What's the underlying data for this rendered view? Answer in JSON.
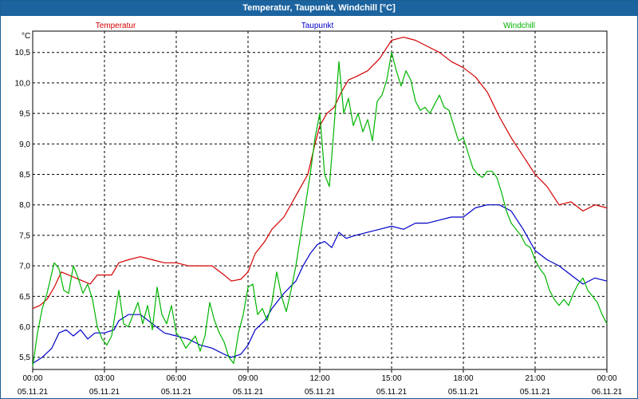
{
  "window": {
    "title": "Temperatur, Taupunkt, Windchill [°C]"
  },
  "chart_data": {
    "type": "line",
    "title": "Temperatur, Taupunkt, Windchill [°C]",
    "ylabel": "°C",
    "xlabel": "",
    "ylim": [
      5.3,
      10.85
    ],
    "xlim": [
      0,
      24
    ],
    "grid": true,
    "legend_position": "top",
    "y_ticks": [
      "5,5",
      "6,0",
      "6,5",
      "7,0",
      "7,5",
      "8,0",
      "8,5",
      "9,0",
      "9,5",
      "10,0",
      "10,5"
    ],
    "y_tick_values": [
      5.5,
      6.0,
      6.5,
      7.0,
      7.5,
      8.0,
      8.5,
      9.0,
      9.5,
      10.0,
      10.5
    ],
    "x_ticks": [
      {
        "t": 0,
        "time": "00:00",
        "date": "05.11.21"
      },
      {
        "t": 3,
        "time": "03:00",
        "date": "05.11.21"
      },
      {
        "t": 6,
        "time": "06:00",
        "date": "05.11.21"
      },
      {
        "t": 9,
        "time": "09:00",
        "date": "05.11.21"
      },
      {
        "t": 12,
        "time": "12:00",
        "date": "05.11.21"
      },
      {
        "t": 15,
        "time": "15:00",
        "date": "05.11.21"
      },
      {
        "t": 18,
        "time": "18:00",
        "date": "05.11.21"
      },
      {
        "t": 21,
        "time": "21:00",
        "date": "05.11.21"
      },
      {
        "t": 24,
        "time": "00:00",
        "date": "06.11.21"
      }
    ],
    "series": [
      {
        "name": "Temperatur",
        "color": "#d40000",
        "points": [
          [
            0,
            6.3
          ],
          [
            0.3,
            6.35
          ],
          [
            0.6,
            6.45
          ],
          [
            0.9,
            6.65
          ],
          [
            1.2,
            6.9
          ],
          [
            1.5,
            6.85
          ],
          [
            1.8,
            6.8
          ],
          [
            2.1,
            6.75
          ],
          [
            2.4,
            6.7
          ],
          [
            2.7,
            6.85
          ],
          [
            3.0,
            6.85
          ],
          [
            3.3,
            6.85
          ],
          [
            3.6,
            7.05
          ],
          [
            4.0,
            7.1
          ],
          [
            4.5,
            7.15
          ],
          [
            5.0,
            7.1
          ],
          [
            5.5,
            7.05
          ],
          [
            6.0,
            7.05
          ],
          [
            6.5,
            7.0
          ],
          [
            7.0,
            7.0
          ],
          [
            7.5,
            7.0
          ],
          [
            8.0,
            6.85
          ],
          [
            8.3,
            6.75
          ],
          [
            8.7,
            6.78
          ],
          [
            9.0,
            6.9
          ],
          [
            9.3,
            7.2
          ],
          [
            9.7,
            7.4
          ],
          [
            10.0,
            7.6
          ],
          [
            10.5,
            7.8
          ],
          [
            11.0,
            8.15
          ],
          [
            11.5,
            8.5
          ],
          [
            11.8,
            9.0
          ],
          [
            12.0,
            9.3
          ],
          [
            12.3,
            9.5
          ],
          [
            12.6,
            9.6
          ],
          [
            12.9,
            9.85
          ],
          [
            13.2,
            10.05
          ],
          [
            13.5,
            10.1
          ],
          [
            14.0,
            10.2
          ],
          [
            14.5,
            10.4
          ],
          [
            15.0,
            10.7
          ],
          [
            15.5,
            10.75
          ],
          [
            16.0,
            10.7
          ],
          [
            16.5,
            10.6
          ],
          [
            17.0,
            10.5
          ],
          [
            17.5,
            10.35
          ],
          [
            18.0,
            10.25
          ],
          [
            18.5,
            10.1
          ],
          [
            19.0,
            9.85
          ],
          [
            19.5,
            9.45
          ],
          [
            20.0,
            9.1
          ],
          [
            20.5,
            8.8
          ],
          [
            21.0,
            8.5
          ],
          [
            21.5,
            8.3
          ],
          [
            22.0,
            8.0
          ],
          [
            22.5,
            8.05
          ],
          [
            23.0,
            7.9
          ],
          [
            23.5,
            8.0
          ],
          [
            24.0,
            7.95
          ]
        ]
      },
      {
        "name": "Taupunkt",
        "color": "#0000c8",
        "points": [
          [
            0,
            5.4
          ],
          [
            0.4,
            5.5
          ],
          [
            0.8,
            5.65
          ],
          [
            1.1,
            5.9
          ],
          [
            1.4,
            5.95
          ],
          [
            1.7,
            5.85
          ],
          [
            2.0,
            5.95
          ],
          [
            2.3,
            5.8
          ],
          [
            2.6,
            5.9
          ],
          [
            3.0,
            5.9
          ],
          [
            3.4,
            5.95
          ],
          [
            3.6,
            6.1
          ],
          [
            4.0,
            6.2
          ],
          [
            4.5,
            6.2
          ],
          [
            5.0,
            6.05
          ],
          [
            5.5,
            5.9
          ],
          [
            6.0,
            5.85
          ],
          [
            6.5,
            5.8
          ],
          [
            7.0,
            5.7
          ],
          [
            7.5,
            5.65
          ],
          [
            8.0,
            5.55
          ],
          [
            8.3,
            5.5
          ],
          [
            8.7,
            5.55
          ],
          [
            9.0,
            5.7
          ],
          [
            9.3,
            5.95
          ],
          [
            9.7,
            6.1
          ],
          [
            10.0,
            6.3
          ],
          [
            10.5,
            6.55
          ],
          [
            11.0,
            6.75
          ],
          [
            11.3,
            7.0
          ],
          [
            11.6,
            7.2
          ],
          [
            11.9,
            7.35
          ],
          [
            12.2,
            7.4
          ],
          [
            12.5,
            7.3
          ],
          [
            12.8,
            7.55
          ],
          [
            13.1,
            7.45
          ],
          [
            13.5,
            7.5
          ],
          [
            14.0,
            7.55
          ],
          [
            14.5,
            7.6
          ],
          [
            15.0,
            7.65
          ],
          [
            15.5,
            7.6
          ],
          [
            16.0,
            7.7
          ],
          [
            16.5,
            7.7
          ],
          [
            17.0,
            7.75
          ],
          [
            17.5,
            7.8
          ],
          [
            18.0,
            7.8
          ],
          [
            18.5,
            7.95
          ],
          [
            19.0,
            8.0
          ],
          [
            19.5,
            8.0
          ],
          [
            20.0,
            7.9
          ],
          [
            20.5,
            7.6
          ],
          [
            21.0,
            7.25
          ],
          [
            21.5,
            7.1
          ],
          [
            22.0,
            7.0
          ],
          [
            22.5,
            6.85
          ],
          [
            23.0,
            6.7
          ],
          [
            23.5,
            6.8
          ],
          [
            24.0,
            6.75
          ]
        ]
      },
      {
        "name": "Windchill",
        "color": "#00b400",
        "points": [
          [
            0,
            5.35
          ],
          [
            0.2,
            5.9
          ],
          [
            0.4,
            6.3
          ],
          [
            0.6,
            6.55
          ],
          [
            0.9,
            7.05
          ],
          [
            1.1,
            6.95
          ],
          [
            1.3,
            6.6
          ],
          [
            1.5,
            6.55
          ],
          [
            1.7,
            7.0
          ],
          [
            1.9,
            6.8
          ],
          [
            2.1,
            6.55
          ],
          [
            2.3,
            6.7
          ],
          [
            2.5,
            6.45
          ],
          [
            2.7,
            6.0
          ],
          [
            2.9,
            5.8
          ],
          [
            3.1,
            5.7
          ],
          [
            3.3,
            5.85
          ],
          [
            3.6,
            6.6
          ],
          [
            3.8,
            6.05
          ],
          [
            4.0,
            6.0
          ],
          [
            4.2,
            6.2
          ],
          [
            4.4,
            6.4
          ],
          [
            4.6,
            6.05
          ],
          [
            4.8,
            6.35
          ],
          [
            5.0,
            5.95
          ],
          [
            5.2,
            6.65
          ],
          [
            5.4,
            6.2
          ],
          [
            5.6,
            6.05
          ],
          [
            5.8,
            6.35
          ],
          [
            6.0,
            5.9
          ],
          [
            6.2,
            5.8
          ],
          [
            6.4,
            5.65
          ],
          [
            6.6,
            5.75
          ],
          [
            6.8,
            5.85
          ],
          [
            7.0,
            5.6
          ],
          [
            7.2,
            5.85
          ],
          [
            7.4,
            6.4
          ],
          [
            7.6,
            6.1
          ],
          [
            7.8,
            5.9
          ],
          [
            8.0,
            5.75
          ],
          [
            8.2,
            5.5
          ],
          [
            8.4,
            5.4
          ],
          [
            8.6,
            5.9
          ],
          [
            8.8,
            6.2
          ],
          [
            9.0,
            6.65
          ],
          [
            9.2,
            6.7
          ],
          [
            9.4,
            6.2
          ],
          [
            9.6,
            6.3
          ],
          [
            9.8,
            6.1
          ],
          [
            10.0,
            6.4
          ],
          [
            10.2,
            6.9
          ],
          [
            10.4,
            6.5
          ],
          [
            10.6,
            6.25
          ],
          [
            10.8,
            6.6
          ],
          [
            11.0,
            7.0
          ],
          [
            11.2,
            7.5
          ],
          [
            11.4,
            8.0
          ],
          [
            11.6,
            8.5
          ],
          [
            11.8,
            9.1
          ],
          [
            12.0,
            9.5
          ],
          [
            12.2,
            8.5
          ],
          [
            12.4,
            8.3
          ],
          [
            12.6,
            9.3
          ],
          [
            12.8,
            10.35
          ],
          [
            13.0,
            9.5
          ],
          [
            13.2,
            9.75
          ],
          [
            13.4,
            9.3
          ],
          [
            13.6,
            9.5
          ],
          [
            13.8,
            9.2
          ],
          [
            14.0,
            9.4
          ],
          [
            14.2,
            9.05
          ],
          [
            14.4,
            9.7
          ],
          [
            14.6,
            9.8
          ],
          [
            14.8,
            10.05
          ],
          [
            15.0,
            10.5
          ],
          [
            15.2,
            10.2
          ],
          [
            15.4,
            9.95
          ],
          [
            15.6,
            10.2
          ],
          [
            15.8,
            10.05
          ],
          [
            16.0,
            9.7
          ],
          [
            16.2,
            9.55
          ],
          [
            16.4,
            9.6
          ],
          [
            16.6,
            9.5
          ],
          [
            16.8,
            9.65
          ],
          [
            17.0,
            9.8
          ],
          [
            17.2,
            9.6
          ],
          [
            17.4,
            9.55
          ],
          [
            17.6,
            9.3
          ],
          [
            17.8,
            9.05
          ],
          [
            18.0,
            9.1
          ],
          [
            18.2,
            8.85
          ],
          [
            18.4,
            8.6
          ],
          [
            18.6,
            8.5
          ],
          [
            18.8,
            8.45
          ],
          [
            19.0,
            8.55
          ],
          [
            19.2,
            8.55
          ],
          [
            19.4,
            8.45
          ],
          [
            19.6,
            8.2
          ],
          [
            19.8,
            7.9
          ],
          [
            20.0,
            7.7
          ],
          [
            20.2,
            7.6
          ],
          [
            20.4,
            7.5
          ],
          [
            20.6,
            7.35
          ],
          [
            20.8,
            7.3
          ],
          [
            21.0,
            7.1
          ],
          [
            21.2,
            6.95
          ],
          [
            21.4,
            6.85
          ],
          [
            21.6,
            6.6
          ],
          [
            21.8,
            6.45
          ],
          [
            22.0,
            6.35
          ],
          [
            22.2,
            6.45
          ],
          [
            22.4,
            6.35
          ],
          [
            22.6,
            6.55
          ],
          [
            22.8,
            6.7
          ],
          [
            23.0,
            6.8
          ],
          [
            23.2,
            6.6
          ],
          [
            23.4,
            6.5
          ],
          [
            23.6,
            6.4
          ],
          [
            23.8,
            6.2
          ],
          [
            24.0,
            6.05
          ]
        ]
      }
    ]
  }
}
